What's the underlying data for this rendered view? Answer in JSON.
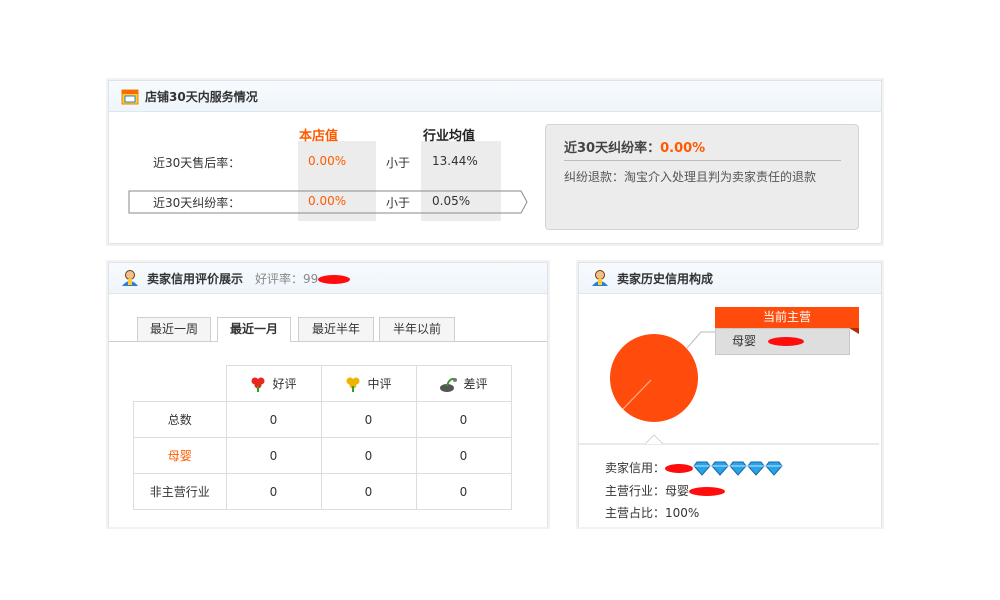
{
  "service_panel": {
    "title": "店铺30天内服务情况",
    "col_store": "本店值",
    "col_industry": "行业均值",
    "rows": [
      {
        "label": "近30天售后率：",
        "store": "0.00%",
        "compare": "小于",
        "industry": "13.44%"
      },
      {
        "label": "近30天纠纷率：",
        "store": "0.00%",
        "compare": "小于",
        "industry": "0.05%"
      }
    ],
    "detail_title": "近30天纠纷率：",
    "detail_value": "0.00%",
    "detail_desc": "纠纷退款：淘宝介入处理且判为卖家责任的退款"
  },
  "credit_panel": {
    "title": "卖家信用评价展示",
    "rating_label": "好评率：",
    "rating_value": "99",
    "tabs": [
      "最近一周",
      "最近一月",
      "最近半年",
      "半年以前"
    ],
    "active_tab": 1,
    "headers": [
      "好评",
      "中评",
      "差评"
    ],
    "rows": [
      {
        "label": "总数",
        "values": [
          "0",
          "0",
          "0"
        ]
      },
      {
        "label": "母婴",
        "values": [
          "0",
          "0",
          "0"
        ]
      },
      {
        "label": "非主营行业",
        "values": [
          "0",
          "0",
          "0"
        ]
      }
    ]
  },
  "history_panel": {
    "title": "卖家历史信用构成",
    "badge": "当前主营",
    "category": "母婴",
    "pie_share": 1.0,
    "credit_label": "卖家信用：",
    "credit_diamonds": 5,
    "industry_label": "主营行业：",
    "industry_value": "母婴",
    "share_label": "主营占比：",
    "share_value": "100%"
  },
  "colors": {
    "accent": "#ff5a00",
    "pie": "#ff4c0c",
    "redact": "#ff0c0c",
    "diamond": "#2aa2e8"
  }
}
